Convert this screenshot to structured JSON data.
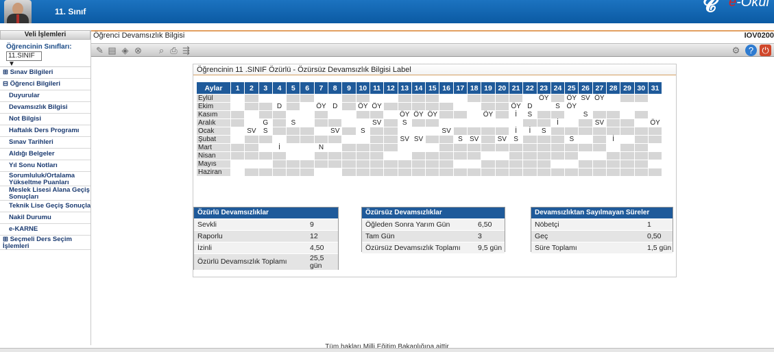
{
  "header": {
    "class_title": "11. Sınıf",
    "logo_text": "e-Okul"
  },
  "sidebar": {
    "title": "Veli İşlemleri",
    "class_label": "Öğrencinin Sınıfları:",
    "class_select_value": "11.SINIF",
    "items": [
      {
        "label": "⊞ Sınav Bilgileri",
        "type": "group"
      },
      {
        "label": "⊟ Öğrenci Bilgileri",
        "type": "group"
      },
      {
        "label": "Duyurular",
        "type": "sub"
      },
      {
        "label": "Devamsızlık Bilgisi",
        "type": "sub"
      },
      {
        "label": "Not Bilgisi",
        "type": "sub"
      },
      {
        "label": "Haftalık Ders Programı",
        "type": "sub"
      },
      {
        "label": "Sınav Tarihleri",
        "type": "sub"
      },
      {
        "label": "Aldığı Belgeler",
        "type": "sub"
      },
      {
        "label": "Yıl Sonu Notları",
        "type": "sub"
      },
      {
        "label": "Sorumluluk/Ortalama Yükseltme Puanları",
        "type": "sub2"
      },
      {
        "label": "Meslek Lisesi Alana Geçiş Sonuçları",
        "type": "sub2"
      },
      {
        "label": "Teknik Lise Geçiş Sonuçları",
        "type": "sub"
      },
      {
        "label": "Nakil Durumu",
        "type": "sub"
      },
      {
        "label": "e-KARNE",
        "type": "sub"
      },
      {
        "label": "⊞ Seçmeli Ders Seçim İşlemleri",
        "type": "group2"
      }
    ]
  },
  "main": {
    "title": "Öğrenci Devamsızlık Bilgisi",
    "page_code": "IOV0200"
  },
  "toolbar": {
    "left_icons": [
      "pencil-icon",
      "document-icon",
      "tag-icon",
      "cancel-icon",
      "search-icon",
      "print-icon",
      "export-icon"
    ],
    "right_icons": [
      "tools-icon",
      "help-icon",
      "exit-icon"
    ]
  },
  "panel": {
    "title": "Öğrencinin 11 .SINIF Özürlü - Özürsüz Devamsızlık Bilgisi Label",
    "month_header": "Aylar",
    "days": [
      "1",
      "2",
      "3",
      "4",
      "5",
      "6",
      "7",
      "8",
      "9",
      "10",
      "11",
      "12",
      "13",
      "14",
      "15",
      "16",
      "17",
      "18",
      "19",
      "20",
      "21",
      "22",
      "23",
      "24",
      "25",
      "26",
      "27",
      "28",
      "29",
      "30",
      "31"
    ],
    "rows": [
      {
        "month": "Eylül",
        "cells": [
          "",
          "",
          "",
          "",
          "",
          "",
          "",
          "",
          "",
          "",
          "",
          "",
          "",
          "",
          "",
          "",
          "",
          "",
          "",
          "",
          "",
          "",
          "ÖY",
          "",
          "ÖY",
          "SV",
          "ÖY",
          "",
          "",
          "",
          ""
        ]
      },
      {
        "month": "Ekim",
        "cells": [
          "",
          "",
          "",
          "D",
          "",
          "",
          "ÖY",
          "D",
          "",
          "ÖY",
          "ÖY",
          "",
          "",
          "",
          "",
          "",
          "",
          "",
          "",
          "",
          "ÖY",
          "D",
          "",
          "S",
          "ÖY",
          "",
          "",
          "",
          "",
          "",
          ""
        ]
      },
      {
        "month": "Kasım",
        "cells": [
          "",
          "",
          "",
          "",
          "",
          "",
          "",
          "",
          "",
          "",
          "",
          "",
          "ÖY",
          "ÖY",
          "ÖY",
          "",
          "",
          "",
          "ÖY",
          "",
          "İ",
          "S",
          "",
          "",
          "",
          "S",
          "",
          "",
          "",
          "",
          ""
        ]
      },
      {
        "month": "Aralık",
        "cells": [
          "",
          "",
          "G",
          "",
          "S",
          "",
          "",
          "",
          "",
          "",
          "SV",
          "",
          "S",
          "",
          "",
          "",
          "",
          "",
          "",
          "",
          "",
          "",
          "",
          "İ",
          "",
          "",
          "SV",
          "",
          "",
          "",
          "ÖY"
        ]
      },
      {
        "month": "Ocak",
        "cells": [
          "",
          "SV",
          "S",
          "",
          "",
          "",
          "",
          "SV",
          "",
          "S",
          "",
          "",
          "",
          "",
          "",
          "SV",
          "",
          "",
          "",
          "",
          "İ",
          "İ",
          "S",
          "",
          "",
          "",
          "",
          "",
          "",
          "",
          ""
        ]
      },
      {
        "month": "Şubat",
        "cells": [
          "",
          "",
          "",
          "",
          "",
          "",
          "",
          "",
          "",
          "",
          "",
          "",
          "SV",
          "SV",
          "",
          "",
          "S",
          "SV",
          "",
          "SV",
          "S",
          "",
          "",
          "",
          "S",
          "",
          "",
          "İ",
          "",
          "",
          ""
        ]
      },
      {
        "month": "Mart",
        "cells": [
          "",
          "",
          "",
          "İ",
          "",
          "",
          "N",
          "",
          "",
          "",
          "",
          "",
          "",
          "",
          "",
          "",
          "",
          "",
          "",
          "",
          "",
          "",
          "",
          "",
          "",
          "",
          "",
          "",
          "",
          "",
          ""
        ]
      },
      {
        "month": "Nisan",
        "cells": [
          "",
          "",
          "",
          "",
          "",
          "",
          "",
          "",
          "",
          "",
          "",
          "",
          "",
          "",
          "",
          "",
          "",
          "",
          "",
          "",
          "",
          "",
          "",
          "",
          "",
          "",
          "",
          "",
          "",
          "",
          ""
        ]
      },
      {
        "month": "Mayıs",
        "cells": [
          "",
          "",
          "",
          "",
          "",
          "",
          "",
          "",
          "",
          "",
          "",
          "",
          "",
          "",
          "",
          "",
          "",
          "",
          "",
          "",
          "",
          "",
          "",
          "",
          "",
          "",
          "",
          "",
          "",
          "",
          ""
        ]
      },
      {
        "month": "Haziran",
        "cells": [
          "",
          "",
          "",
          "",
          "",
          "",
          "",
          "",
          "",
          "",
          "",
          "",
          "",
          "",
          "",
          "",
          "",
          "",
          "",
          "",
          "",
          "",
          "",
          "",
          "",
          "",
          "",
          "",
          "",
          "",
          ""
        ]
      }
    ],
    "gray_pattern": [
      [
        0,
        1,
        0,
        0,
        1,
        1,
        0,
        0,
        1,
        1,
        0,
        0,
        1,
        1,
        1,
        0,
        0,
        1,
        1,
        1,
        1,
        0,
        0,
        1,
        1,
        0,
        0,
        0,
        1,
        1,
        0
      ],
      [
        0,
        1,
        1,
        0,
        1,
        0,
        0,
        0,
        1,
        0,
        0,
        1,
        1,
        1,
        1,
        1,
        0,
        0,
        1,
        1,
        0,
        0,
        0,
        0,
        0,
        0,
        0,
        0,
        0,
        0,
        0
      ],
      [
        1,
        0,
        1,
        1,
        0,
        0,
        1,
        0,
        0,
        1,
        1,
        0,
        0,
        0,
        0,
        1,
        1,
        0,
        0,
        1,
        0,
        0,
        1,
        1,
        0,
        0,
        1,
        1,
        0,
        1,
        0
      ],
      [
        1,
        0,
        0,
        1,
        0,
        0,
        1,
        1,
        0,
        0,
        0,
        1,
        0,
        1,
        1,
        0,
        0,
        0,
        0,
        0,
        0,
        1,
        1,
        0,
        0,
        1,
        0,
        1,
        1,
        0,
        0
      ],
      [
        0,
        0,
        0,
        1,
        1,
        1,
        0,
        0,
        1,
        0,
        1,
        1,
        0,
        0,
        0,
        0,
        1,
        1,
        1,
        1,
        0,
        0,
        0,
        1,
        1,
        1,
        1,
        1,
        1,
        1,
        1
      ],
      [
        0,
        1,
        1,
        0,
        1,
        1,
        1,
        1,
        0,
        0,
        1,
        1,
        0,
        0,
        1,
        1,
        0,
        0,
        1,
        0,
        0,
        1,
        1,
        1,
        0,
        0,
        1,
        0,
        0,
        1,
        1
      ],
      [
        1,
        1,
        0,
        0,
        0,
        0,
        0,
        0,
        1,
        1,
        1,
        1,
        0,
        0,
        0,
        1,
        1,
        1,
        1,
        1,
        1,
        1,
        1,
        1,
        1,
        1,
        1,
        0,
        1,
        1,
        0
      ],
      [
        1,
        1,
        1,
        1,
        0,
        0,
        1,
        1,
        1,
        1,
        1,
        0,
        0,
        1,
        1,
        1,
        1,
        1,
        0,
        0,
        1,
        1,
        1,
        1,
        1,
        0,
        0,
        1,
        1,
        1,
        1
      ],
      [
        0,
        0,
        0,
        1,
        1,
        1,
        1,
        1,
        1,
        1,
        1,
        1,
        1,
        1,
        1,
        1,
        0,
        0,
        1,
        1,
        1,
        1,
        1,
        0,
        0,
        1,
        1,
        1,
        1,
        1,
        0
      ],
      [
        0,
        1,
        1,
        1,
        1,
        1,
        0,
        0,
        1,
        1,
        1,
        1,
        1,
        1,
        1,
        1,
        1,
        1,
        1,
        1,
        1,
        1,
        1,
        1,
        1,
        1,
        1,
        1,
        1,
        1,
        1
      ]
    ]
  },
  "ozurlu": {
    "title": "Özürlü Devamsızlıklar",
    "rows": [
      {
        "label": "Sevkli",
        "value": "9"
      },
      {
        "label": "Raporlu",
        "value": "12"
      },
      {
        "label": "İzinli",
        "value": "4,50"
      },
      {
        "label": "Özürlü Devamsızlık Toplamı",
        "value": "25,5 gün"
      }
    ]
  },
  "ozursuz": {
    "title": "Özürsüz Devamsızlıklar",
    "rows": [
      {
        "label": "Öğleden Sonra Yarım Gün",
        "value": "6,50"
      },
      {
        "label": "Tam Gün",
        "value": "3"
      },
      {
        "label": "Özürsüz Devamsızlık Toplamı",
        "value": "9,5 gün"
      }
    ]
  },
  "sayilmayan": {
    "title": "Devamsızlıktan Sayılmayan Süreler",
    "rows": [
      {
        "label": "Nöbetçi",
        "value": "1"
      },
      {
        "label": "Geç",
        "value": "0,50"
      },
      {
        "label": "Süre Toplamı",
        "value": "1,5 gün"
      }
    ]
  },
  "footer": {
    "text": "Tüm hakları Milli Eğitim Bakanlığına aittir"
  }
}
